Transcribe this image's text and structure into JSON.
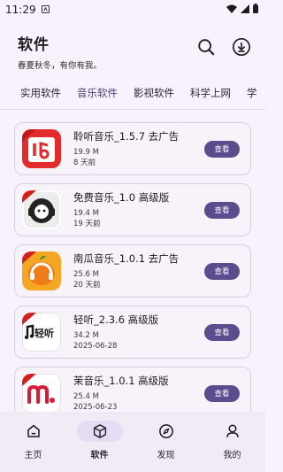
{
  "status": {
    "time": "11:29"
  },
  "header": {
    "title": "软件",
    "subtitle": "春夏秋冬，有你有我。"
  },
  "tabs": [
    {
      "label": "实用软件"
    },
    {
      "label": "音乐软件",
      "active": true
    },
    {
      "label": "影视软件"
    },
    {
      "label": "科学上网"
    },
    {
      "label": "学"
    }
  ],
  "apps": [
    {
      "name": "聆听音乐_1.5.7 去广告",
      "size": "19.9 M",
      "date": "8 天前",
      "button": "查看",
      "icon": "lingting-music-icon"
    },
    {
      "name": "免费音乐_1.0 高级版",
      "size": "19.4 M",
      "date": "19 天前",
      "button": "查看",
      "icon": "free-music-icon"
    },
    {
      "name": "南瓜音乐_1.0.1 去广告",
      "size": "25.6 M",
      "date": "20 天前",
      "button": "查看",
      "icon": "pumpkin-music-icon"
    },
    {
      "name": "轻听_2.3.6 高级版",
      "size": "34.2 M",
      "date": "2025-06-28",
      "button": "查看",
      "icon": "qingting-icon"
    },
    {
      "name": "茉音乐_1.0.1 高级版",
      "size": "25.4 M",
      "date": "2025-06-23",
      "button": "查看",
      "icon": "mo-music-icon"
    }
  ],
  "icon_texts": {
    "qingting_logo": "轻听"
  },
  "bottom_nav": [
    {
      "label": "主页",
      "icon": "home-icon"
    },
    {
      "label": "软件",
      "icon": "box-icon",
      "active": true
    },
    {
      "label": "发现",
      "icon": "compass-icon"
    },
    {
      "label": "我的",
      "icon": "person-icon"
    }
  ],
  "colors": {
    "accent": "#5b4b8f",
    "background": "#f7f2fb"
  }
}
